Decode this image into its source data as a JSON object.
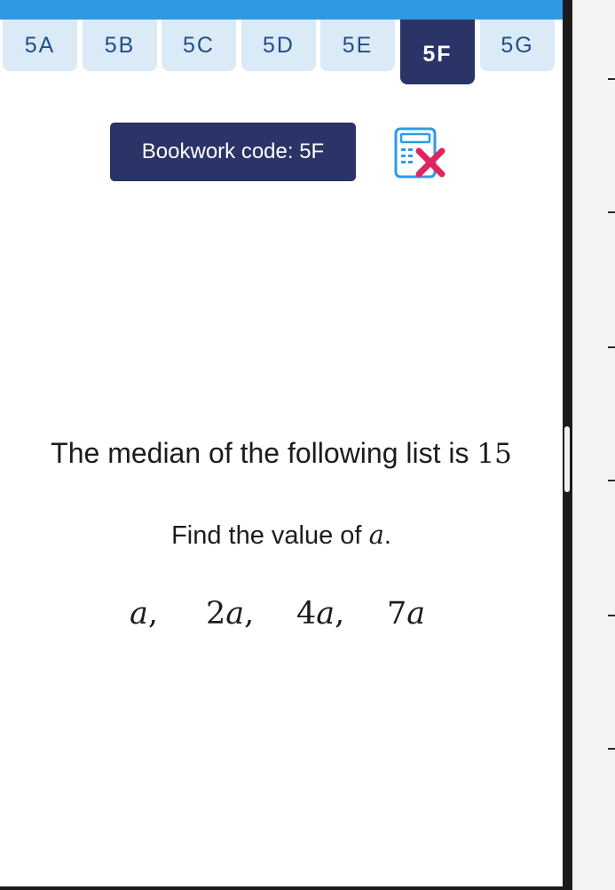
{
  "tabs": [
    {
      "label": "5A",
      "active": false
    },
    {
      "label": "5B",
      "active": false
    },
    {
      "label": "5C",
      "active": false
    },
    {
      "label": "5D",
      "active": false
    },
    {
      "label": "5E",
      "active": false
    },
    {
      "label": "5F",
      "active": true
    },
    {
      "label": "5G",
      "active": false
    }
  ],
  "bookwork": {
    "label": "Bookwork code: 5F"
  },
  "calculator": {
    "icon": "calculator-not-allowed-icon",
    "status": "not allowed"
  },
  "question": {
    "text": "The median of the following list is",
    "value": "15",
    "instruction_prefix": "Find the value of",
    "instruction_var": "a",
    "instruction_suffix": "."
  },
  "terms": [
    {
      "coef": "",
      "var": "a",
      "sep": ","
    },
    {
      "coef": "2",
      "var": "a",
      "sep": ","
    },
    {
      "coef": "4",
      "var": "a",
      "sep": ","
    },
    {
      "coef": "7",
      "var": "a",
      "sep": ""
    }
  ],
  "colors": {
    "topbar": "#2e9ae6",
    "tab_bg": "#dbeaf7",
    "tab_text": "#1f4e86",
    "active": "#2a3466",
    "calc_outline": "#2e9ae6",
    "cross": "#e0245e"
  }
}
